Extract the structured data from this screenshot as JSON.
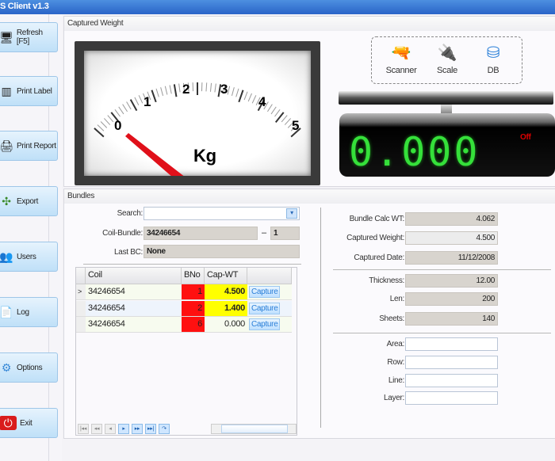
{
  "window": {
    "title": "S Client v1.3"
  },
  "sidebar": {
    "items": [
      {
        "label": "Refresh [F5]",
        "icon": "refresh-icon"
      },
      {
        "label": "Print Label",
        "icon": "barcode-icon"
      },
      {
        "label": "Print Report",
        "icon": "printer-icon"
      },
      {
        "label": "Export",
        "icon": "export-icon"
      },
      {
        "label": "Users",
        "icon": "users-icon"
      },
      {
        "label": "Log",
        "icon": "document-icon"
      },
      {
        "label": "Options",
        "icon": "gear-icon"
      },
      {
        "label": "Exit",
        "icon": "power-icon"
      }
    ]
  },
  "captured": {
    "title": "Captured Weight",
    "gauge": {
      "ticks": [
        "0",
        "1",
        "2",
        "3",
        "4",
        "5"
      ],
      "unit": "Kg",
      "value": 0,
      "min": 0,
      "max": 5
    },
    "status": {
      "scanner": "Scanner",
      "scale": "Scale",
      "db": "DB"
    },
    "display": {
      "value": "0.000",
      "state": "Off"
    }
  },
  "bundles": {
    "title": "Bundles",
    "search_label": "Search:",
    "search_value": "",
    "coil_bundle_label": "Coil-Bundle:",
    "coil_value": "34246654",
    "dash": "–",
    "bundle_value": "1",
    "last_bc_label": "Last BC:",
    "last_bc_value": "None",
    "grid": {
      "headers": [
        "Coil",
        "BNo",
        "Cap-WT"
      ],
      "capture_label": "Capture",
      "rows": [
        {
          "coil": "34246654",
          "bno": "1",
          "capwt": "4.500",
          "selected": true
        },
        {
          "coil": "34246654",
          "bno": "2",
          "capwt": "1.400"
        },
        {
          "coil": "34246654",
          "bno": "6",
          "capwt": "0.000"
        }
      ],
      "selector": ">"
    },
    "details": {
      "bundle_calc_label": "Bundle Calc WT:",
      "bundle_calc": "4.062",
      "captured_weight_label": "Captured Weight:",
      "captured_weight": "4.500",
      "captured_date_label": "Captured Date:",
      "captured_date": "11/12/2008",
      "thickness_label": "Thickness:",
      "thickness": "12.00",
      "len_label": "Len:",
      "len": "200",
      "sheets_label": "Sheets:",
      "sheets": "140",
      "area_label": "Area:",
      "area": "",
      "row_label": "Row:",
      "row": "",
      "line_label": "Line:",
      "line": "",
      "layer_label": "Layer:",
      "layer": ""
    }
  },
  "colors": {
    "bno_bg": "#ff1010",
    "capwt_bg": "#ffff00",
    "digits": "#35e03a"
  }
}
